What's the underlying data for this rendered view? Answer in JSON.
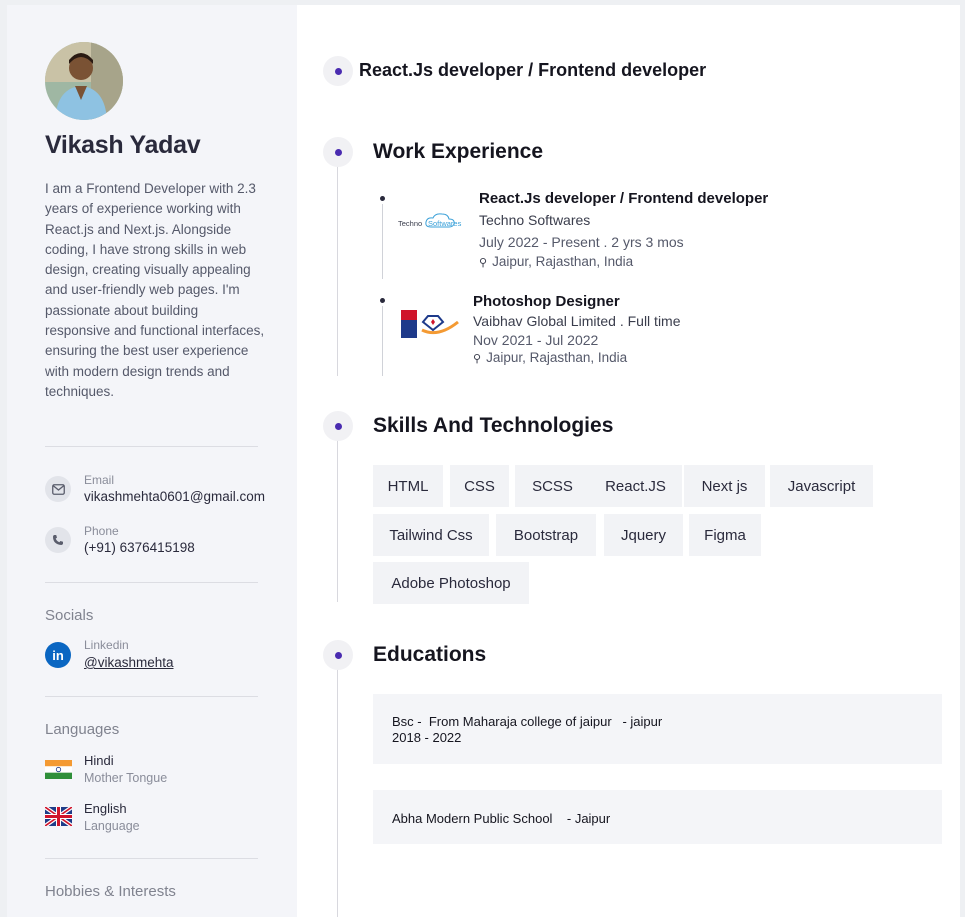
{
  "profile": {
    "name": "Vikash Yadav",
    "bio": "I am a Frontend Developer with 2.3 years of experience working with React.js and Next.js. Alongside coding, I have strong skills in web design, creating visually appealing and user-friendly web pages. I'm passionate about building responsive and functional interfaces, ensuring the best user experience with modern design trends and techniques.",
    "headline": "React.Js developer / Frontend developer"
  },
  "contact": {
    "email_label": "Email",
    "email": "vikashmehta0601@gmail.com",
    "phone_label": "Phone",
    "phone": "(+91) 6376415198"
  },
  "socials": {
    "heading": "Socials",
    "linkedin_label": "Linkedin",
    "linkedin_handle": "@vikashmehta",
    "linkedin_badge": "in"
  },
  "languages": {
    "heading": "Languages",
    "items": [
      {
        "name": "Hindi",
        "level": "Mother Tongue"
      },
      {
        "name": "English",
        "level": "Language"
      }
    ]
  },
  "hobbies": {
    "heading": "Hobbies & Interests"
  },
  "work": {
    "heading": "Work Experience",
    "jobs": [
      {
        "title": "React.Js developer / Frontend developer",
        "company": "Techno Softwares",
        "period": "July 2022  -  Present  .  2 yrs 3 mos",
        "location": "Jaipur, Rajasthan, India",
        "logo_text_a": "Techno",
        "logo_text_b": "Softwares"
      },
      {
        "title": "Photoshop Designer",
        "company": "Vaibhav Global Limited . Full time",
        "period": "Nov 2021  -  Jul 2022",
        "location": "Jaipur, Rajasthan, India"
      }
    ]
  },
  "skills": {
    "heading": "Skills And Technologies",
    "items": [
      "HTML",
      "CSS",
      "SCSS",
      "React.JS",
      "Next js",
      "Javascript",
      "Tailwind Css",
      "Bootstrap",
      "Jquery",
      "Figma",
      "Adobe Photoshop"
    ]
  },
  "education": {
    "heading": "Educations",
    "items": [
      {
        "line1": "Bsc -  From Maharaja college of jaipur   - jaipur",
        "line2": "2018 - 2022"
      },
      {
        "line1": "Abha Modern Public School    - Jaipur"
      }
    ]
  },
  "colors": {
    "accent_dot": "#4a2bb0",
    "sidebar_bg": "#f4f5f9",
    "linkedin_blue": "#0a66c2"
  },
  "icons": {
    "email": "envelope-icon",
    "phone": "phone-icon",
    "location": "map-pin-icon"
  }
}
